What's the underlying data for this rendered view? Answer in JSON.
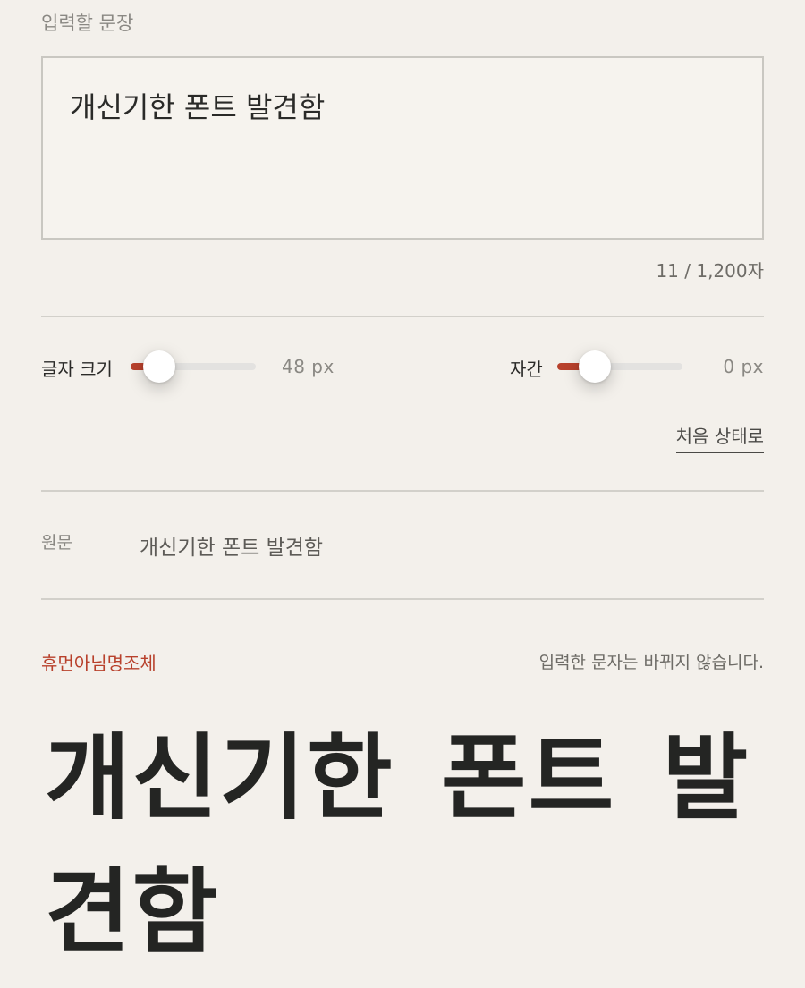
{
  "input": {
    "label": "입력할 문장",
    "value": "개신기한 폰트 발견함",
    "char_count": "11 / 1,200자"
  },
  "controls": {
    "font_size": {
      "label": "글자 크기",
      "value_text": "48 px",
      "fill_fraction": 0.23
    },
    "letter_spacing": {
      "label": "자간",
      "value_text": "0 px",
      "fill_fraction": 0.3
    },
    "reset_label": "처음 상태로"
  },
  "original": {
    "label": "원문",
    "text": "개신기한 폰트 발견함"
  },
  "preview": {
    "font_name": "휴먼아님명조체",
    "note": "입력한 문자는 바뀌지 않습니다.",
    "text": "개신기한 폰트 발견함"
  },
  "colors": {
    "accent": "#b8412c",
    "background": "#f3f0eb",
    "text": "#2a2a28"
  }
}
